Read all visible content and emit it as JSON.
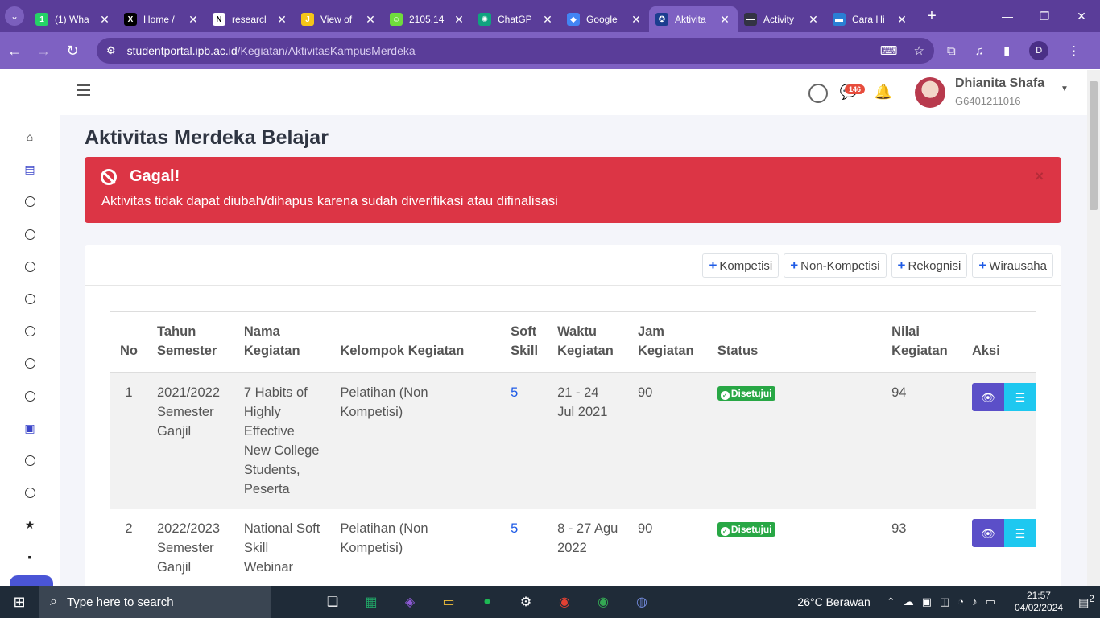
{
  "browser": {
    "tabs": [
      {
        "title": "(1) Wha",
        "icon": "whatsapp-icon",
        "color": "#25d366",
        "glyph": "1"
      },
      {
        "title": "Home /",
        "icon": "x-icon",
        "color": "#000000",
        "glyph": "X"
      },
      {
        "title": "researcl",
        "icon": "notion-icon",
        "color": "#ffffff",
        "glyph": "N"
      },
      {
        "title": "View of",
        "icon": "journal-icon",
        "color": "#f5c518",
        "glyph": "J"
      },
      {
        "title": "2105.14",
        "icon": "arxiv-icon",
        "color": "#6fdc3c",
        "glyph": "☺"
      },
      {
        "title": "ChatGP",
        "icon": "chatgpt-icon",
        "color": "#10a37f",
        "glyph": "✺"
      },
      {
        "title": "Google",
        "icon": "google-scholar-icon",
        "color": "#4285f4",
        "glyph": "◆"
      },
      {
        "title": "Aktivita",
        "icon": "ipb-icon",
        "color": "#1c3d8f",
        "glyph": "✪"
      },
      {
        "title": "Activity",
        "icon": "activity-icon",
        "color": "#334",
        "glyph": "—"
      },
      {
        "title": "Cara Hi",
        "icon": "cara-icon",
        "color": "#2a7fd4",
        "glyph": "▬"
      }
    ],
    "url_host": "studentportal.ipb.ac.id",
    "url_path": "/Kegiatan/AktivitasKampusMerdeka",
    "profile_initial": "D"
  },
  "header": {
    "chat_count": "146",
    "user_name": "Dhianita Shafa",
    "user_id": "G6401211016"
  },
  "page": {
    "title": "Aktivitas Merdeka Belajar"
  },
  "alert": {
    "title": "Gagal!",
    "message": "Aktivitas tidak dapat diubah/dihapus karena sudah diverifikasi atau difinalisasi",
    "close": "×"
  },
  "buttons": {
    "kompetisi": "Kompetisi",
    "non_kompetisi": "Non-Kompetisi",
    "rekognisi": "Rekognisi",
    "wirausaha": "Wirausaha"
  },
  "table": {
    "headers": {
      "no": "No",
      "tahun_a": "Tahun",
      "tahun_b": "Semester",
      "nama_a": "Nama",
      "nama_b": "Kegiatan",
      "kelompok": "Kelompok Kegiatan",
      "soft_a": "Soft",
      "soft_b": "Skill",
      "waktu_a": "Waktu",
      "waktu_b": "Kegiatan",
      "jam_a": "Jam",
      "jam_b": "Kegiatan",
      "status": "Status",
      "nilai_a": "Nilai",
      "nilai_b": "Kegiatan",
      "aksi": "Aksi"
    },
    "rows": [
      {
        "no": "1",
        "tahun": "2021/2022 Semester Ganjil",
        "nama": "7 Habits of Highly Effective New College Students, Peserta",
        "kelompok": "Pelatihan (Non Kompetisi)",
        "soft_skill": "5",
        "waktu": "21 - 24 Jul 2021",
        "jam": "90",
        "status": "Disetujui",
        "nilai": "94"
      },
      {
        "no": "2",
        "tahun": "2022/2023 Semester Ganjil",
        "nama": "National Soft Skill Webinar",
        "kelompok": "Pelatihan (Non Kompetisi)",
        "soft_skill": "5",
        "waktu": "8 - 27 Agu 2022",
        "jam": "90",
        "status": "Disetujui",
        "nilai": "93"
      }
    ]
  },
  "taskbar": {
    "search_placeholder": "Type here to search",
    "weather": "26°C  Berawan",
    "time": "21:57",
    "date": "04/02/2024",
    "notif_count": "2"
  }
}
